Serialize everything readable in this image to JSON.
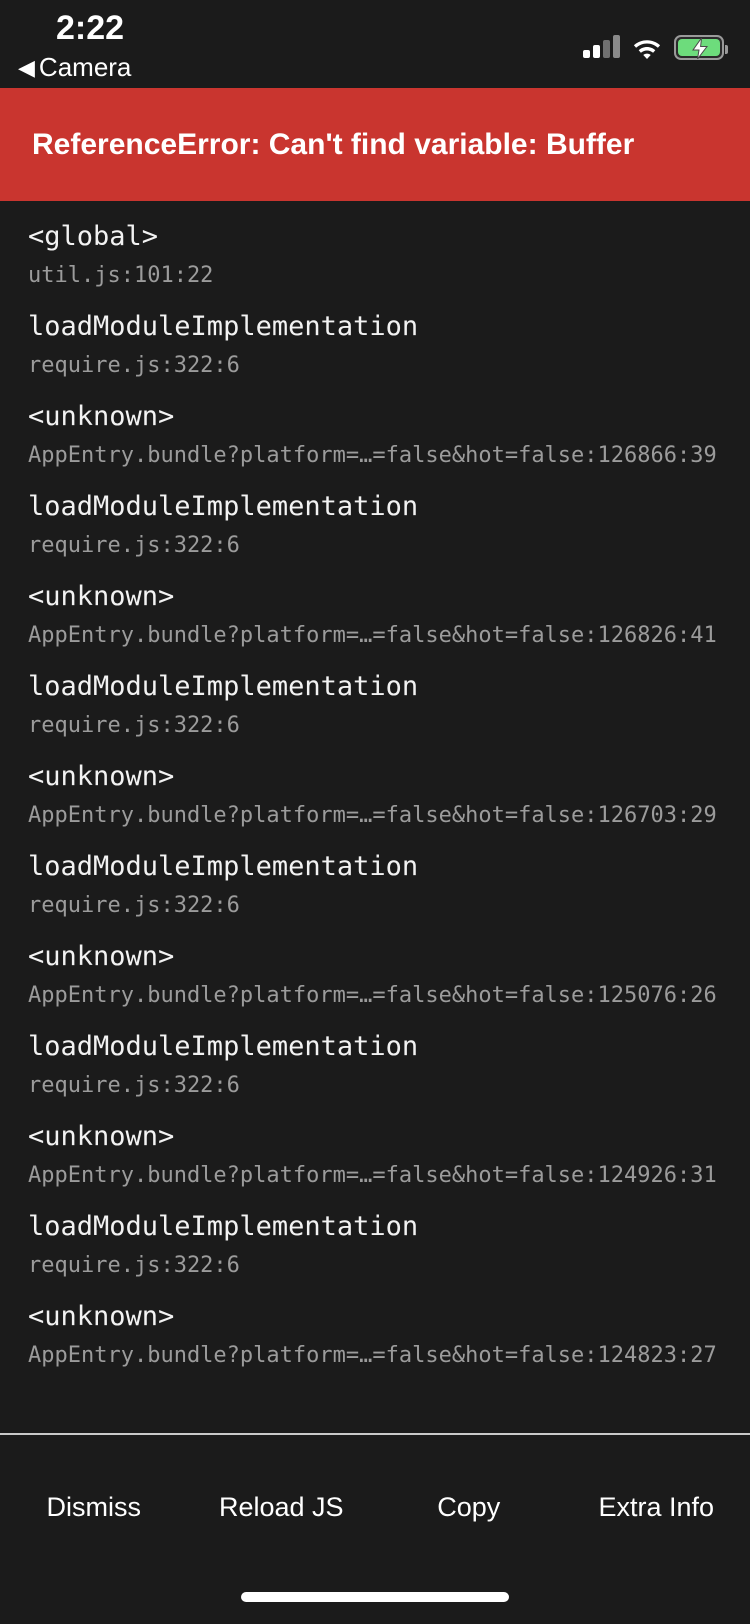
{
  "status_bar": {
    "time": "2:22",
    "back_caret": "◀",
    "back_label": "Camera",
    "signal_icon": "cellular-signal-icon",
    "wifi_icon": "wifi-icon",
    "battery_icon": "battery-charging-icon"
  },
  "banner": {
    "message": "ReferenceError: Can't find variable: Buffer",
    "background_color": "#c9352f",
    "text_color": "#ffffff"
  },
  "stack": {
    "frames": [
      {
        "name": "<global>",
        "location": "util.js:101:22"
      },
      {
        "name": "loadModuleImplementation",
        "location": "require.js:322:6"
      },
      {
        "name": "<unknown>",
        "location": "AppEntry.bundle?platform=…=false&hot=false:126866:39"
      },
      {
        "name": "loadModuleImplementation",
        "location": "require.js:322:6"
      },
      {
        "name": "<unknown>",
        "location": "AppEntry.bundle?platform=…=false&hot=false:126826:41"
      },
      {
        "name": "loadModuleImplementation",
        "location": "require.js:322:6"
      },
      {
        "name": "<unknown>",
        "location": "AppEntry.bundle?platform=…=false&hot=false:126703:29"
      },
      {
        "name": "loadModuleImplementation",
        "location": "require.js:322:6"
      },
      {
        "name": "<unknown>",
        "location": "AppEntry.bundle?platform=…=false&hot=false:125076:26"
      },
      {
        "name": "loadModuleImplementation",
        "location": "require.js:322:6"
      },
      {
        "name": "<unknown>",
        "location": "AppEntry.bundle?platform=…=false&hot=false:124926:31"
      },
      {
        "name": "loadModuleImplementation",
        "location": "require.js:322:6"
      },
      {
        "name": "<unknown>",
        "location": "AppEntry.bundle?platform=…=false&hot=false:124823:27"
      }
    ]
  },
  "toolbar": {
    "dismiss_label": "Dismiss",
    "reload_label": "Reload JS",
    "copy_label": "Copy",
    "extra_info_label": "Extra Info"
  }
}
